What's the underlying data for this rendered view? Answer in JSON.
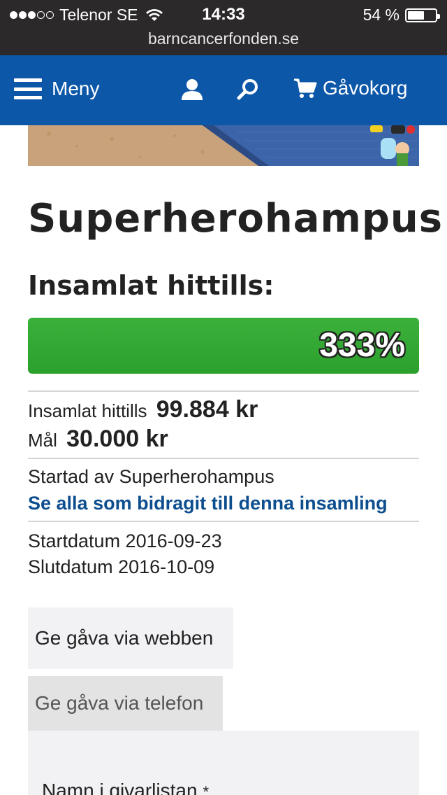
{
  "statusbar": {
    "carrier": "Telenor SE",
    "time": "14:33",
    "battery_text": "54 %",
    "battery_level": 0.54
  },
  "browser": {
    "url": "barncancerfonden.se"
  },
  "nav": {
    "menu_label": "Meny",
    "cart_label": "Gåvokorg"
  },
  "page": {
    "title": "Superherohampus",
    "collected_heading": "Insamlat hittills:"
  },
  "progress": {
    "percent_label": "333%",
    "fill_fraction": 1.0
  },
  "stats": {
    "collected_label": "Insamlat hittills",
    "collected_value": "99.884 kr",
    "goal_label": "Mål",
    "goal_value": "30.000 kr"
  },
  "fundraiser": {
    "started_by": "Startad av Superherohampus",
    "contributors_link": "Se alla som bidragit till denna insamling",
    "start_date": "Startdatum 2016-09-23",
    "end_date": "Slutdatum 2016-10-09"
  },
  "donate_tabs": {
    "web": "Ge gåva via webben",
    "phone": "Ge gåva via telefon"
  },
  "form": {
    "name_label": "Namn i givarlistan",
    "required_mark": "*"
  },
  "colors": {
    "nav_bg": "#0d57a8",
    "progress_green": "#2ca02c",
    "link_blue": "#0d4e8f"
  }
}
